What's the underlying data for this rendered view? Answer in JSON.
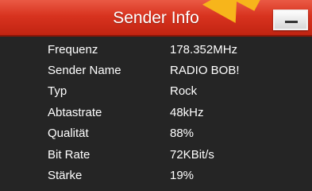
{
  "header": {
    "title": "Sender Info",
    "accent_color": "#d8331f",
    "button_icon": "minimize-icon",
    "pointer_icon": "arrow-pointer-icon"
  },
  "info_rows": [
    {
      "label": "Frequenz",
      "value": "178.352MHz"
    },
    {
      "label": "Sender Name",
      "value": "RADIO BOB!"
    },
    {
      "label": "Typ",
      "value": "Rock"
    },
    {
      "label": "Abtastrate",
      "value": "48kHz"
    },
    {
      "label": "Qualität",
      "value": "88%"
    },
    {
      "label": "Bit Rate",
      "value": "72KBit/s"
    },
    {
      "label": "Stärke",
      "value": "19%"
    }
  ]
}
